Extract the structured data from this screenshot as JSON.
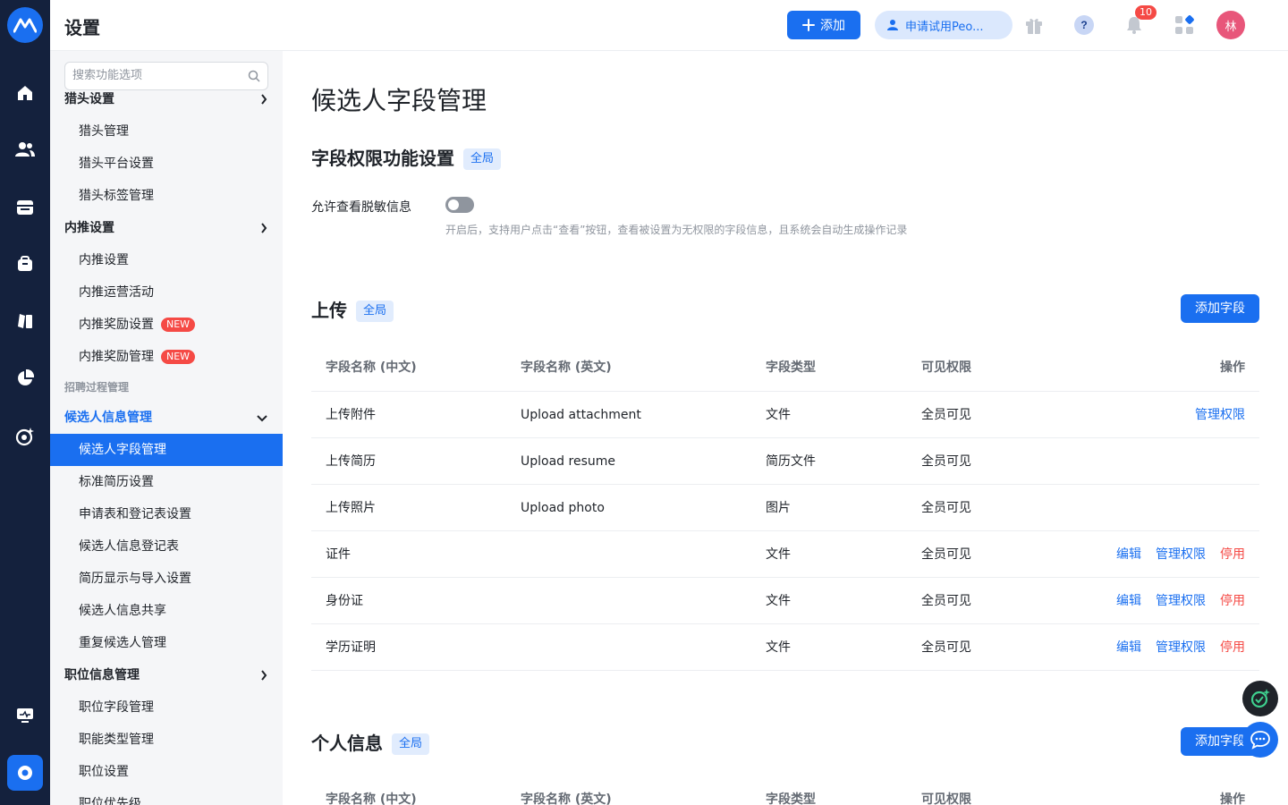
{
  "header": {
    "title": "设置",
    "add_label": "添加",
    "trial_label": "申请试用Peo...",
    "notification_count": "10",
    "avatar_text": "林"
  },
  "rail": {
    "items": [
      "logo-icon",
      "home-icon",
      "people-icon",
      "calendar-icon",
      "briefcase-icon",
      "book-icon",
      "pie-chart-icon",
      "target-icon",
      "monitor-icon",
      "settings-icon"
    ]
  },
  "sidebar": {
    "search_placeholder": "搜索功能选项",
    "items": [
      {
        "label": "猎头设置",
        "kind": "group"
      },
      {
        "label": "猎头管理",
        "kind": "sub"
      },
      {
        "label": "猎头平台设置",
        "kind": "sub"
      },
      {
        "label": "猎头标签管理",
        "kind": "sub"
      },
      {
        "label": "内推设置",
        "kind": "group"
      },
      {
        "label": "内推设置",
        "kind": "sub"
      },
      {
        "label": "内推运营活动",
        "kind": "sub"
      },
      {
        "label": "内推奖励设置",
        "kind": "sub",
        "tag": "NEW"
      },
      {
        "label": "内推奖励管理",
        "kind": "sub",
        "tag": "NEW"
      },
      {
        "label": "招聘过程管理",
        "kind": "label"
      },
      {
        "label": "候选人信息管理",
        "kind": "group-open"
      },
      {
        "label": "候选人字段管理",
        "kind": "selected"
      },
      {
        "label": "标准简历设置",
        "kind": "sub"
      },
      {
        "label": "申请表和登记表设置",
        "kind": "sub"
      },
      {
        "label": "候选人信息登记表",
        "kind": "sub"
      },
      {
        "label": "简历显示与导入设置",
        "kind": "sub"
      },
      {
        "label": "候选人信息共享",
        "kind": "sub"
      },
      {
        "label": "重复候选人管理",
        "kind": "sub"
      },
      {
        "label": "职位信息管理",
        "kind": "group"
      },
      {
        "label": "职位字段管理",
        "kind": "sub"
      },
      {
        "label": "职能类型管理",
        "kind": "sub"
      },
      {
        "label": "职位设置",
        "kind": "sub"
      },
      {
        "label": "职位优先级",
        "kind": "sub"
      }
    ]
  },
  "main": {
    "page_title": "候选人字段管理",
    "permission_section": {
      "title": "字段权限功能设置",
      "scope": "全局",
      "toggle_label": "允许查看脱敏信息",
      "toggle_on": false,
      "hint": "开启后，支持用户点击“查看”按钮，查看被设置为无权限的字段信息，且系统会自动生成操作记录"
    },
    "columns": [
      "字段名称 (中文)",
      "字段名称 (英文)",
      "字段类型",
      "可见权限",
      "操作"
    ],
    "upload_section": {
      "title": "上传",
      "scope": "全局",
      "add_field_label": "添加字段",
      "rows": [
        {
          "cn": "上传附件",
          "en": "Upload attachment",
          "type": "文件",
          "visibility": "全员可见",
          "ops": [
            "管理权限"
          ]
        },
        {
          "cn": "上传简历",
          "en": "Upload resume",
          "type": "简历文件",
          "visibility": "全员可见",
          "ops": []
        },
        {
          "cn": "上传照片",
          "en": "Upload photo",
          "type": "图片",
          "visibility": "全员可见",
          "ops": []
        },
        {
          "cn": "证件",
          "en": "",
          "type": "文件",
          "visibility": "全员可见",
          "ops": [
            "编辑",
            "管理权限",
            "停用"
          ]
        },
        {
          "cn": "身份证",
          "en": "",
          "type": "文件",
          "visibility": "全员可见",
          "ops": [
            "编辑",
            "管理权限",
            "停用"
          ]
        },
        {
          "cn": "学历证明",
          "en": "",
          "type": "文件",
          "visibility": "全员可见",
          "ops": [
            "编辑",
            "管理权限",
            "停用"
          ]
        }
      ]
    },
    "personal_section": {
      "title": "个人信息",
      "scope": "全局",
      "add_field_label": "添加字段"
    }
  },
  "colors": {
    "primary": "#1a6ff0",
    "danger": "#f54a45",
    "rail_bg": "#14213d",
    "sidebar_bg": "#f5f6f8"
  }
}
